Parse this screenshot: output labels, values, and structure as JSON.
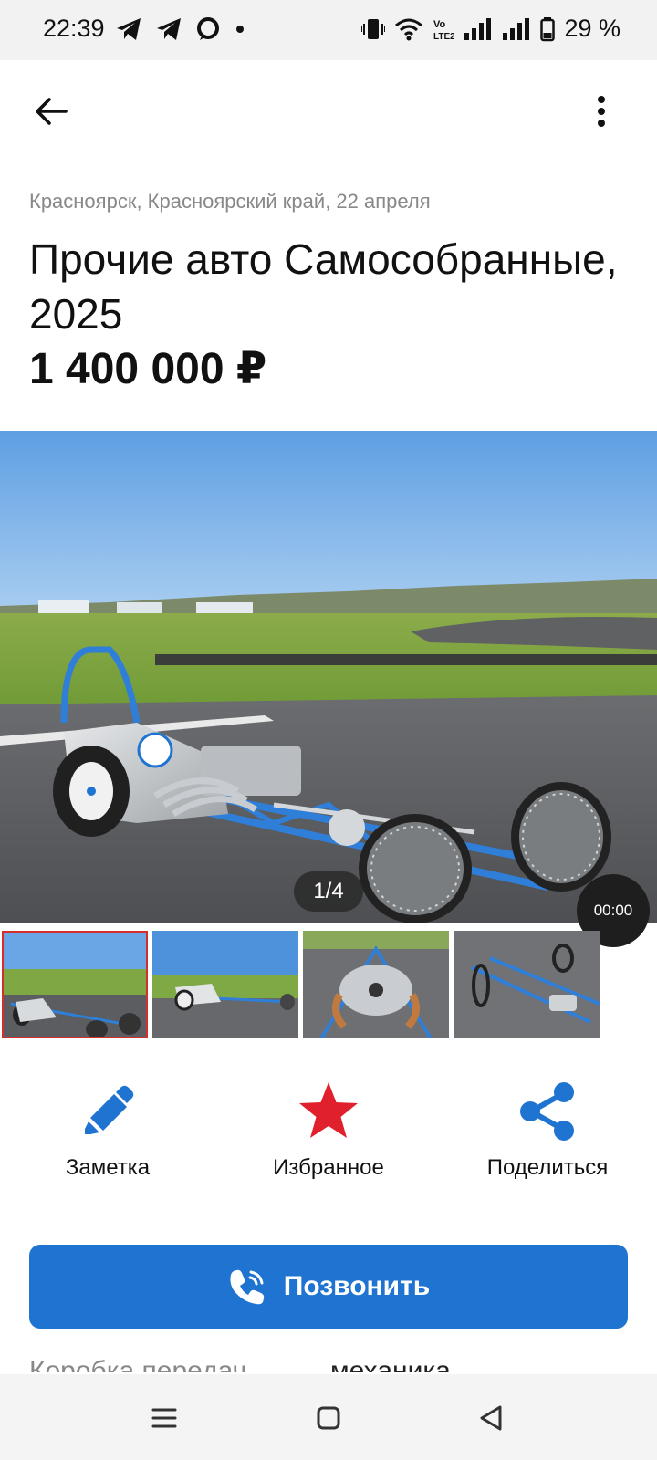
{
  "status_bar": {
    "time": "22:39",
    "battery": "29 %",
    "icons_left": [
      "telegram-icon",
      "telegram-icon",
      "chat-bubble-icon",
      "dot-icon"
    ],
    "icons_right": [
      "vibrate-icon",
      "wifi-icon",
      "volte-icon",
      "signal-icon",
      "signal-icon",
      "battery-icon"
    ]
  },
  "listing": {
    "location": "Красноярск, Красноярский край, 22 апреля",
    "title": "Прочие авто Самособранные, 2025",
    "price": "1 400 000 ₽"
  },
  "gallery": {
    "counter": "1/4",
    "video_duration": "00:00",
    "thumbnails": [
      "photo-1",
      "photo-2",
      "photo-3",
      "photo-4"
    ],
    "active_thumbnail": 1,
    "active_border_color": "#d32f2f"
  },
  "actions": {
    "note": "Заметка",
    "favorite": "Избранное",
    "share": "Поделиться"
  },
  "call": {
    "label": "Позвонить",
    "color": "#1f73d1"
  },
  "spec_peek": {
    "label": "Коробка передач",
    "value": "механика"
  },
  "colors": {
    "accent_blue": "#1f73d1",
    "favorite_red": "#e0202c"
  }
}
